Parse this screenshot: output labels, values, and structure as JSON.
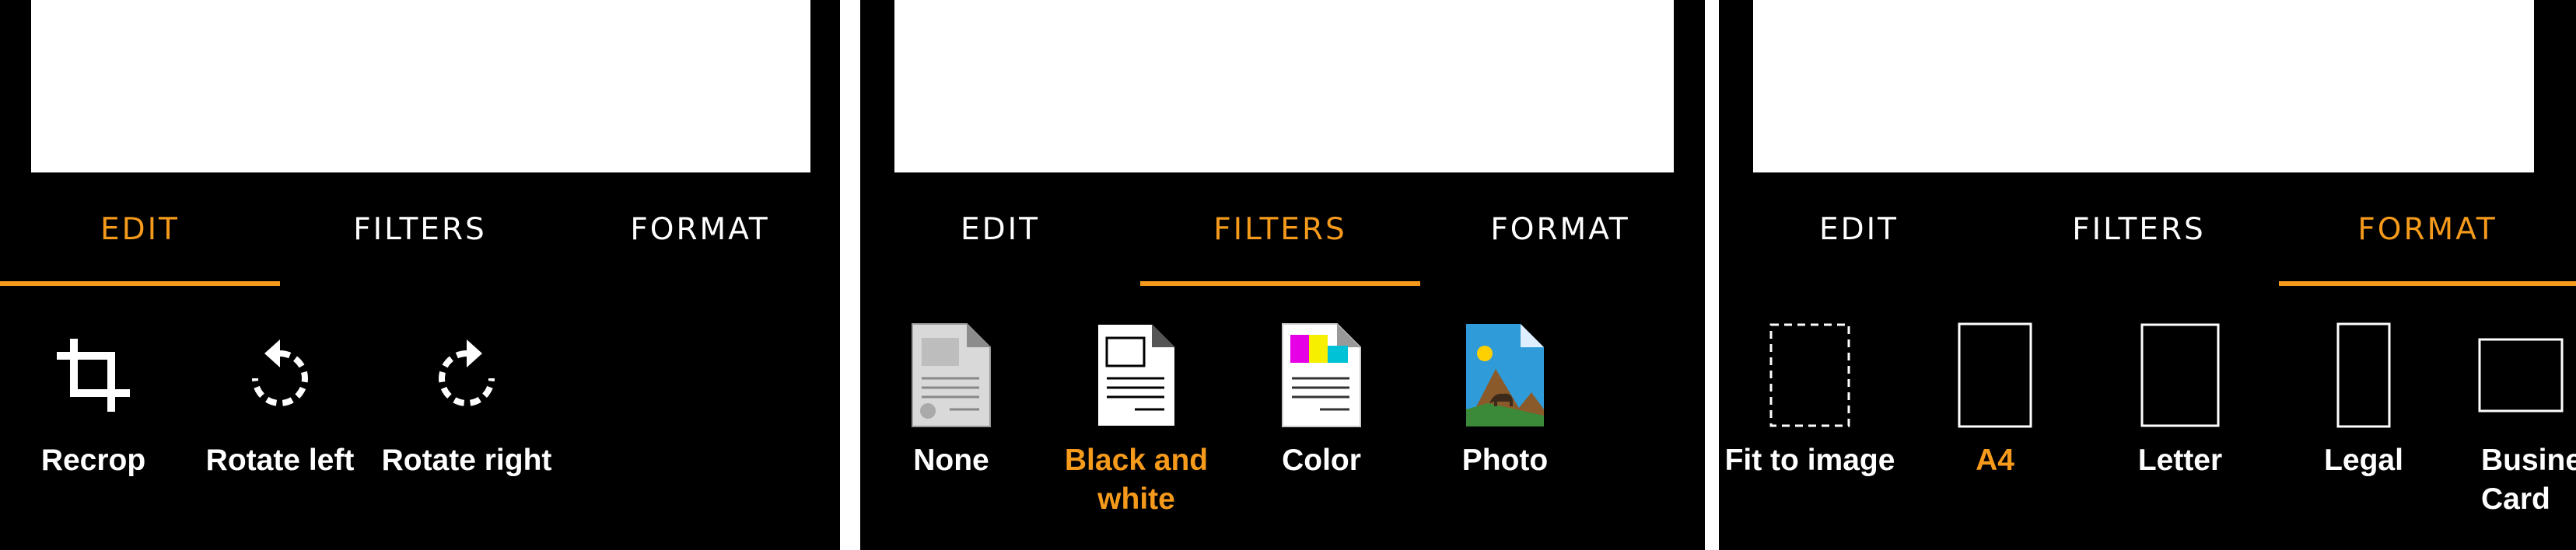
{
  "tabs": {
    "edit": "EDIT",
    "filters": "FILTERS",
    "format": "FORMAT"
  },
  "edit_tools": [
    {
      "label": "Recrop",
      "icon": "crop-icon"
    },
    {
      "label": "Rotate left",
      "icon": "rotate-left-icon"
    },
    {
      "label": "Rotate right",
      "icon": "rotate-right-icon"
    }
  ],
  "filter_options": [
    {
      "label": "None",
      "icon": "no-filter-document-icon"
    },
    {
      "label": "Black and\nwhite",
      "icon": "black-white-document-icon"
    },
    {
      "label": "Color",
      "icon": "color-document-icon"
    },
    {
      "label": "Photo",
      "icon": "photo-document-icon"
    }
  ],
  "format_options": [
    {
      "label": "Fit to image",
      "icon": "fit-to-image-icon"
    },
    {
      "label": "A4",
      "icon": "a4-page-icon"
    },
    {
      "label": "Letter",
      "icon": "letter-page-icon"
    },
    {
      "label": "Legal",
      "icon": "legal-page-icon"
    },
    {
      "label": "Business\nCard",
      "icon": "business-card-icon"
    }
  ],
  "selected": {
    "edit_panel_tab": "EDIT",
    "filters_panel_tab": "FILTERS",
    "format_panel_tab": "FORMAT",
    "filter": "Black and white",
    "format": "A4"
  },
  "colors": {
    "accent": "#f59a1b",
    "background": "#000000",
    "text": "#ffffff"
  }
}
